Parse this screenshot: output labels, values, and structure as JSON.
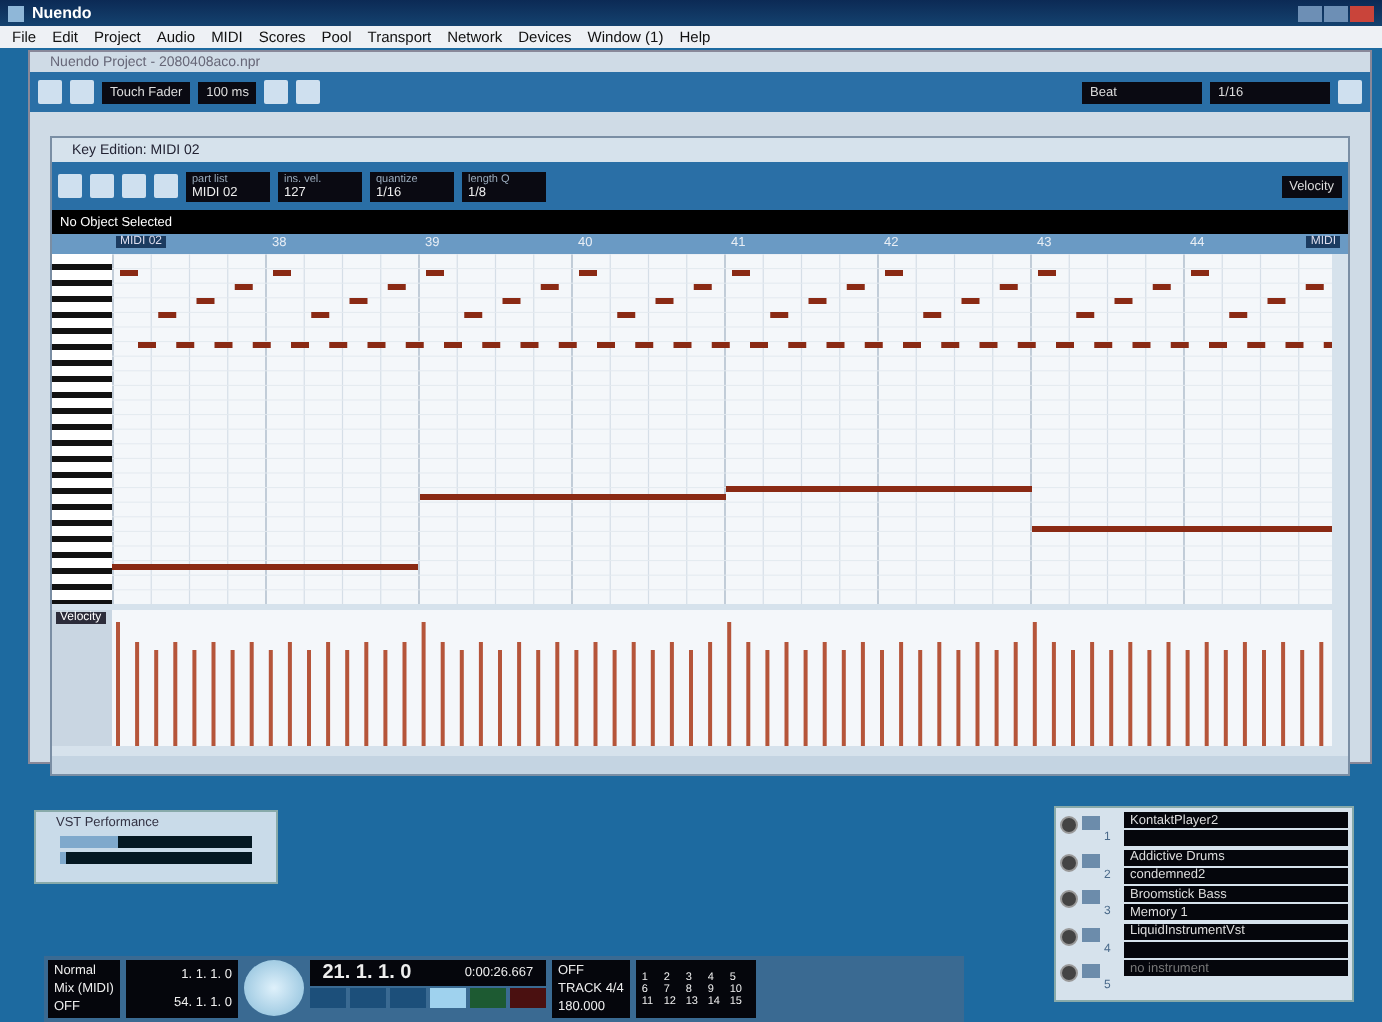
{
  "app_title": "Nuendo",
  "menu": [
    "File",
    "Edit",
    "Project",
    "Audio",
    "MIDI",
    "Scores",
    "Pool",
    "Transport",
    "Network",
    "Devices",
    "Window (1)",
    "Help"
  ],
  "project": {
    "title": "Nuendo Project - 2080408aco.npr",
    "automation_mode": "Touch Fader",
    "preroll": "100 ms",
    "grid_type": "Beat",
    "quantize": "1/16"
  },
  "key_editor": {
    "title": "Key Edition: MIDI 02",
    "fields": [
      {
        "label": "part list",
        "value": "MIDI 02"
      },
      {
        "label": "ins. vel.",
        "value": "127"
      },
      {
        "label": "quantize",
        "value": "1/16"
      },
      {
        "label": "length Q",
        "value": "1/8"
      }
    ],
    "controller": "Velocity",
    "info": "No Object Selected",
    "ruler": {
      "part": "MIDI 02",
      "bars": [
        "38",
        "39",
        "40",
        "41",
        "42",
        "43",
        "44"
      ],
      "end": "MIDI"
    },
    "lane_label": "Velocity"
  },
  "vst_performance": {
    "title": "VST Performance",
    "meters": [
      {
        "level": 0.3
      },
      {
        "level": 0.03
      }
    ]
  },
  "transport": {
    "mode": "Normal",
    "mix": "Mix (MIDI)",
    "auto_quantize": "OFF",
    "left_locator": "1. 1. 1. 0",
    "right_locator": "54. 1. 1. 0",
    "position": "21. 1. 1. 0",
    "time": "0:00:26.667",
    "click": "OFF",
    "sync": "TRACK",
    "signature": "4/4",
    "tempo": "180.000",
    "markers": [
      "1",
      "2",
      "3",
      "4",
      "5",
      "6",
      "7",
      "8",
      "9",
      "10",
      "11",
      "12",
      "13",
      "14",
      "15"
    ]
  },
  "rack": [
    {
      "number": "1",
      "name": "KontaktPlayer2"
    },
    {
      "number": "2",
      "name": "Addictive Drums",
      "program": "condemned2"
    },
    {
      "number": "3",
      "name": "Broomstick Bass",
      "program": "Memory 1"
    },
    {
      "number": "4",
      "name": "LiquidInstrumentVst"
    },
    {
      "number": "5",
      "name": "no instrument",
      "empty": true
    }
  ]
}
